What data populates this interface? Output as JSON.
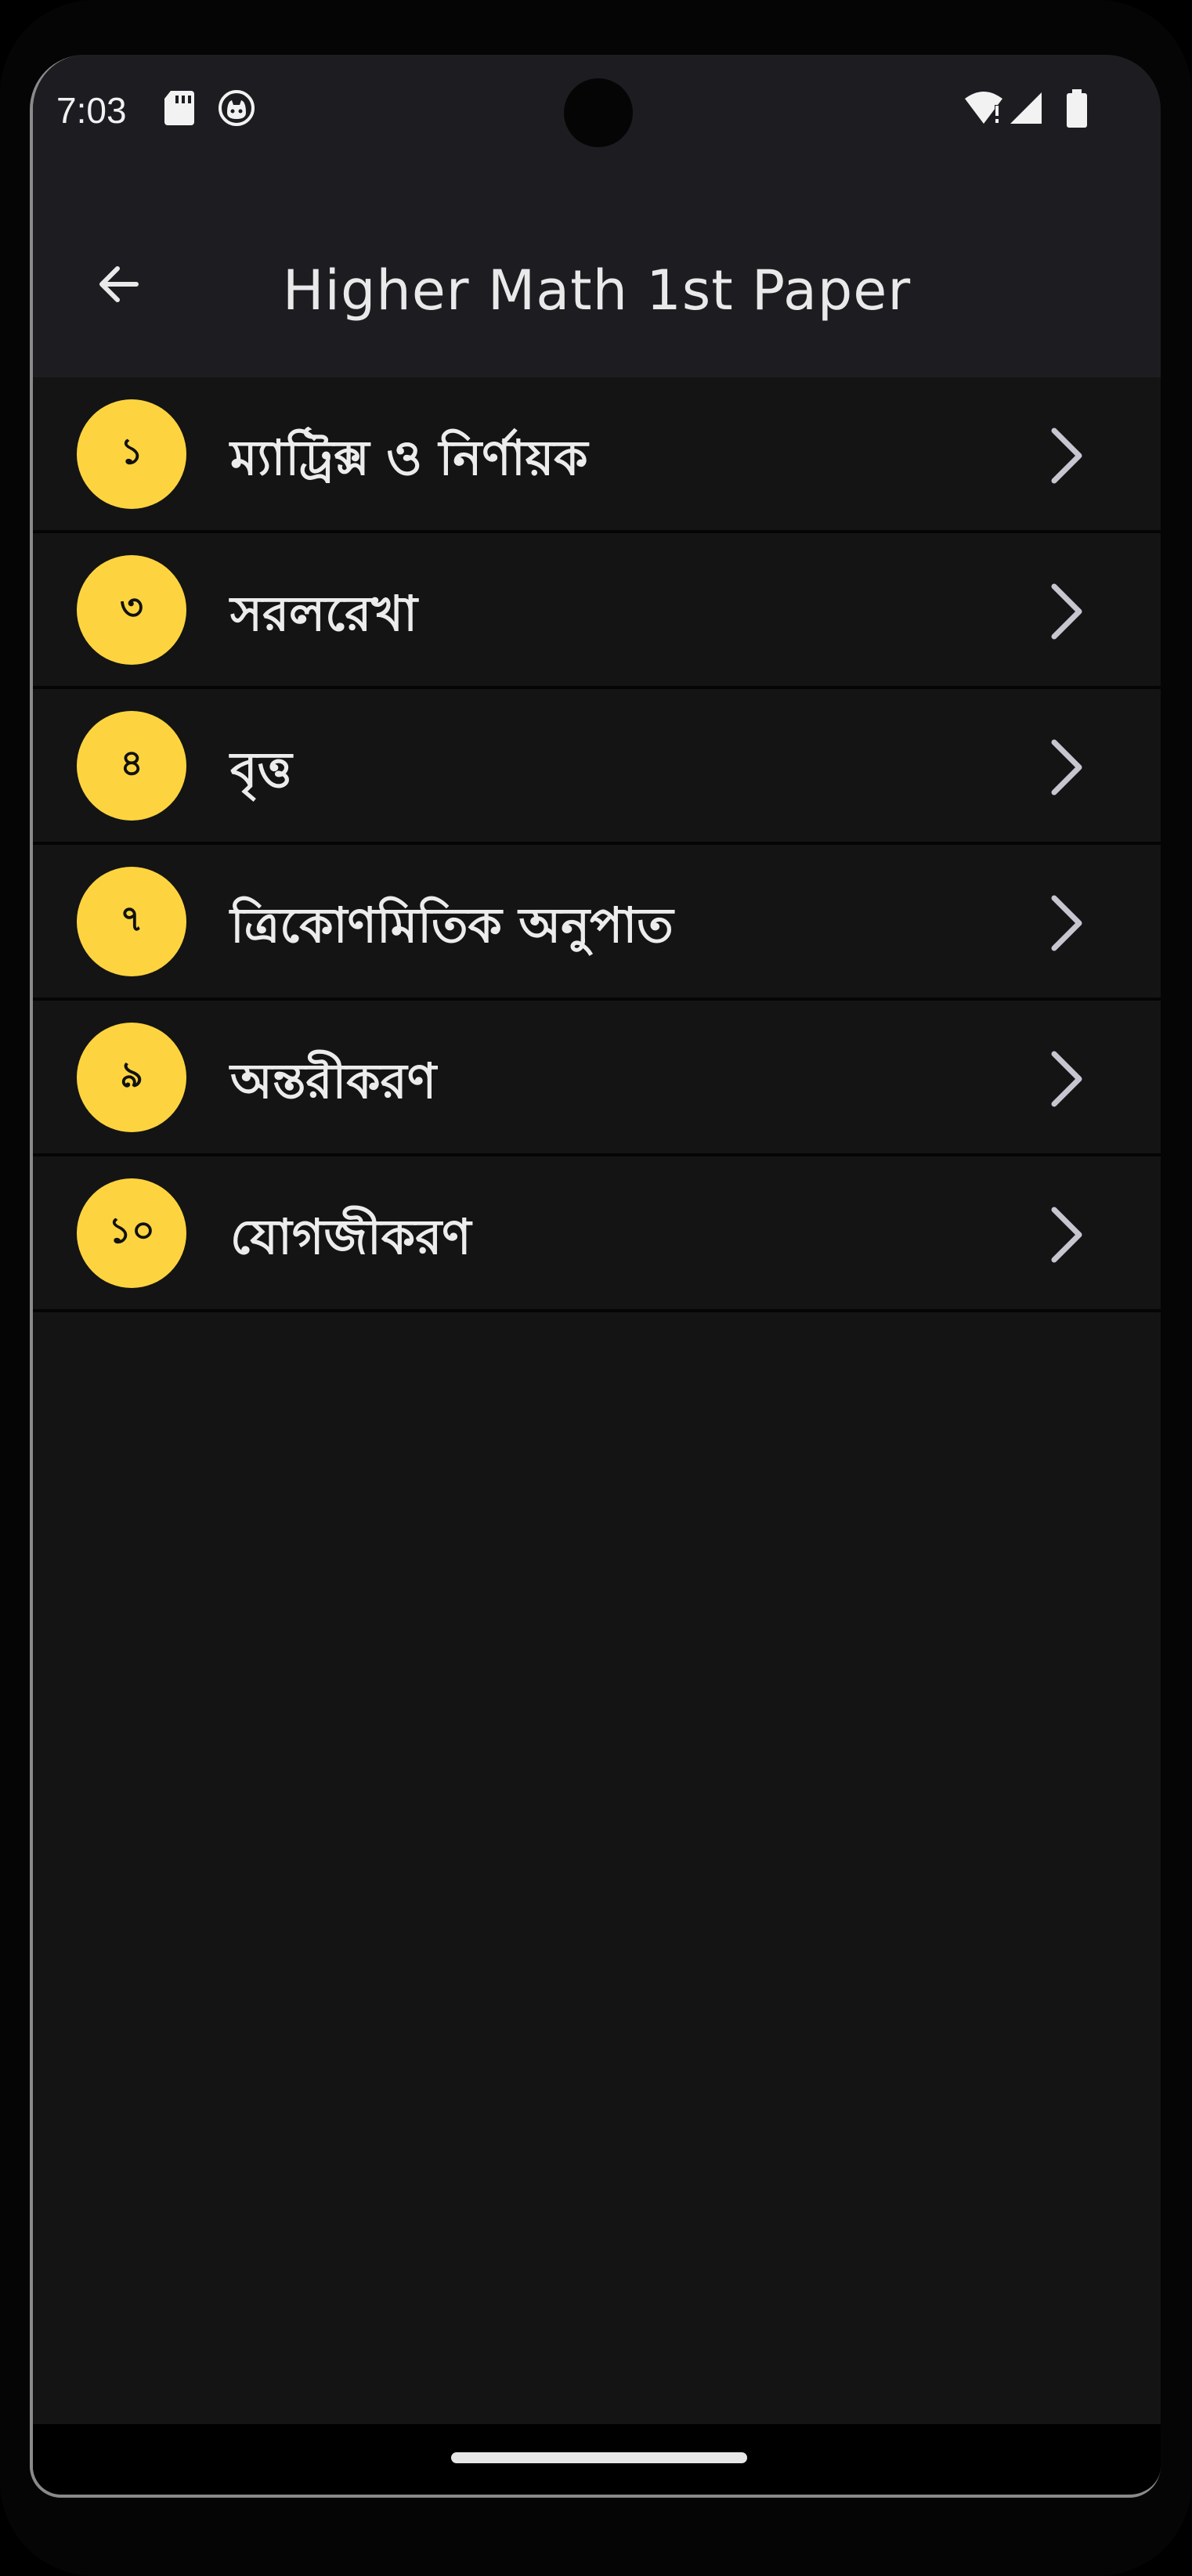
{
  "status_bar": {
    "time": "7:03",
    "icons": [
      "sd-card-icon",
      "cat-face-icon",
      "wifi-alert-icon",
      "signal-icon",
      "battery-icon"
    ]
  },
  "app_bar": {
    "title": "Higher Math 1st Paper",
    "back_icon": "arrow-left-icon"
  },
  "chapters": [
    {
      "number": "১",
      "title": "ম্যাট্রিক্স ও নির্ণায়ক"
    },
    {
      "number": "৩",
      "title": "সরলরেখা"
    },
    {
      "number": "৪",
      "title": "বৃত্ত"
    },
    {
      "number": "৭",
      "title": "ত্রিকোণমিতিক অনুপাত"
    },
    {
      "number": "৯",
      "title": "অন্তরীকরণ"
    },
    {
      "number": "১০",
      "title": "যোগজীকরণ"
    }
  ],
  "colors": {
    "badge": "#fdd43f",
    "background": "#141414",
    "app_bar": "#1d1d21",
    "text": "#ececec",
    "chevron": "#c7c5d0"
  }
}
